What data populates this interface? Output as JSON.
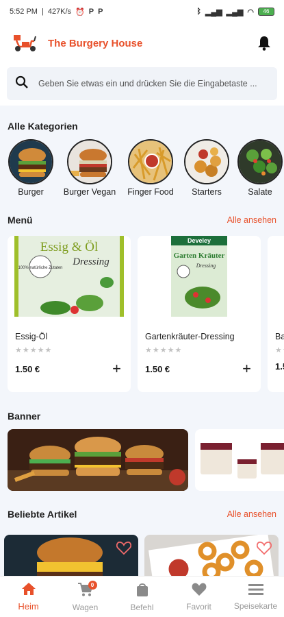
{
  "status_bar": {
    "time": "5:52 PM",
    "speed": "427K/s",
    "battery": "46"
  },
  "app": {
    "title": "The Burgery House"
  },
  "search": {
    "placeholder": "Geben Sie etwas ein und drücken Sie die Eingabetaste ..."
  },
  "categories": {
    "title": "Alle Kategorien",
    "items": [
      {
        "label": "Burger"
      },
      {
        "label": "Burger Vegan"
      },
      {
        "label": "Finger Food"
      },
      {
        "label": "Starters"
      },
      {
        "label": "Salate"
      }
    ]
  },
  "menu": {
    "title": "Menü",
    "see_all": "Alle ansehen",
    "products": [
      {
        "name": "Essig-Öl",
        "price": "1.50 €",
        "image_text_1": "Essig & Öl",
        "image_text_2": "Dressing",
        "image_text_3": "100% natürliche Zutaten"
      },
      {
        "name": "Gartenkräuter-Dressing",
        "price": "1.50 €",
        "image_text_1": "Develey",
        "image_text_2": "Garten Kräuter",
        "image_text_3": "Dressing"
      },
      {
        "name": "Ba",
        "price": "1.5"
      }
    ]
  },
  "banner": {
    "title": "Banner"
  },
  "popular": {
    "title": "Beliebte Artikel",
    "see_all": "Alle ansehen"
  },
  "nav": {
    "items": [
      {
        "label": "Heim",
        "icon": "home-icon"
      },
      {
        "label": "Wagen",
        "icon": "cart-icon",
        "badge": "0"
      },
      {
        "label": "Befehl",
        "icon": "bag-icon"
      },
      {
        "label": "Favorit",
        "icon": "heart-icon"
      },
      {
        "label": "Speisekarte",
        "icon": "menu-icon"
      }
    ]
  },
  "colors": {
    "accent": "#e8512b",
    "background": "#f3f6fb"
  }
}
